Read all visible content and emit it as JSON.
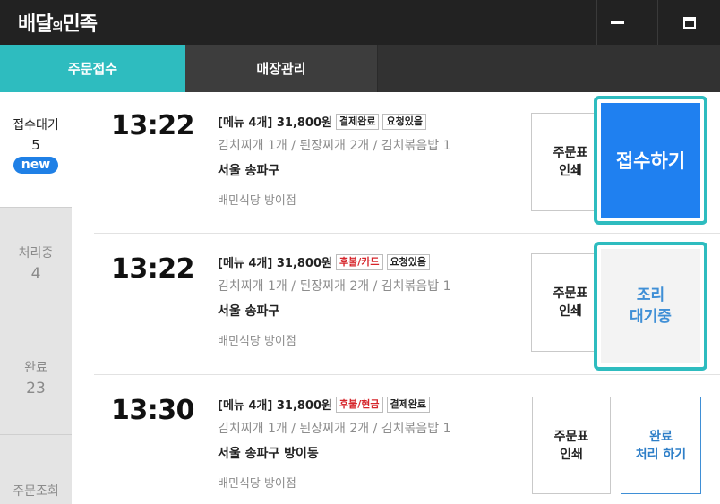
{
  "app": {
    "logo_main": "배달",
    "logo_small": "의",
    "logo_end": "민족"
  },
  "window_controls": {
    "minimize_icon": "minimize-icon",
    "maximize_icon": "maximize-icon"
  },
  "tabs": [
    {
      "label": "주문접수",
      "active": true
    },
    {
      "label": "매장관리",
      "active": false
    }
  ],
  "sidebar": {
    "items": [
      {
        "label": "접수대기",
        "count": "5",
        "badge": "new"
      },
      {
        "label": "처리중",
        "count": "4"
      },
      {
        "label": "완료",
        "count": "23"
      },
      {
        "label": "주문조회"
      }
    ]
  },
  "orders": [
    {
      "time": "13:22",
      "summary": "[메뉴 4개] 31,800원",
      "tags": [
        "결제완료",
        "요청있음"
      ],
      "menu": "김치찌개 1개 / 된장찌개 2개 / 김치볶음밥 1",
      "address": "서울 송파구",
      "store": "배민식당 방이점",
      "print_line1": "주문표",
      "print_line2": "인쇄",
      "action_label": "접수하기"
    },
    {
      "time": "13:22",
      "summary": "[메뉴 4개] 31,800원",
      "tags": [
        "후불/카드",
        "요청있음"
      ],
      "menu": "김치찌개 1개 / 된장찌개 2개 / 김치볶음밥 1",
      "address": "서울 송파구",
      "store": "배민식당 방이점",
      "print_line1": "주문표",
      "print_line2": "인쇄",
      "action_line1": "조리",
      "action_line2": "대기중"
    },
    {
      "time": "13:30",
      "summary": "[메뉴 4개] 31,800원",
      "tags": [
        "후불/현금",
        "결제완료"
      ],
      "menu": "김치찌개 1개 / 된장찌개 2개 / 김치볶음밥 1",
      "address": "서울 송파구 방이동",
      "store": "배민식당 방이점",
      "print_line1": "주문표",
      "print_line2": "인쇄",
      "action_line1": "완료",
      "action_line2": "처리 하기"
    }
  ],
  "colors": {
    "accent_teal": "#2ebcbf",
    "primary_blue": "#1f80f0",
    "tag_red": "#d6252b",
    "titlebar": "#222222"
  }
}
